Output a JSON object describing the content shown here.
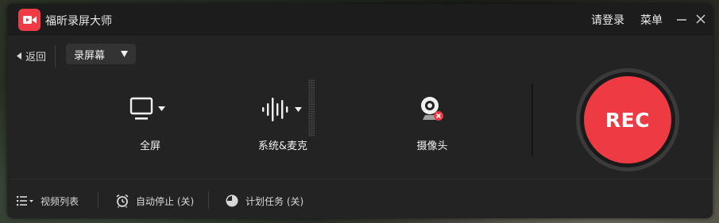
{
  "app": {
    "title": "福昕录屏大师"
  },
  "titlebar": {
    "login_label": "请登录",
    "menu_label": "菜单"
  },
  "toolbar": {
    "back_label": "返回",
    "mode_value": "录屏幕"
  },
  "sources": {
    "screen_label": "全屏",
    "audio_label": "系统&麦克",
    "camera_label": "摄像头"
  },
  "record": {
    "button_label": "REC"
  },
  "bottom": {
    "video_list_label": "视频列表",
    "auto_stop_label": "自动停止 (关)",
    "schedule_label": "计划任务 (关)"
  },
  "colors": {
    "accent": "#ee3a43",
    "window_bg": "#232323",
    "titlebar_bg": "#1c1c1c"
  },
  "icons": {
    "logo": "video-camera-logo-icon",
    "screen": "monitor-icon",
    "audio": "soundwave-icon",
    "camera": "webcam-icon",
    "list": "list-icon",
    "alarm": "alarm-clock-icon",
    "schedule": "pie-clock-icon"
  }
}
